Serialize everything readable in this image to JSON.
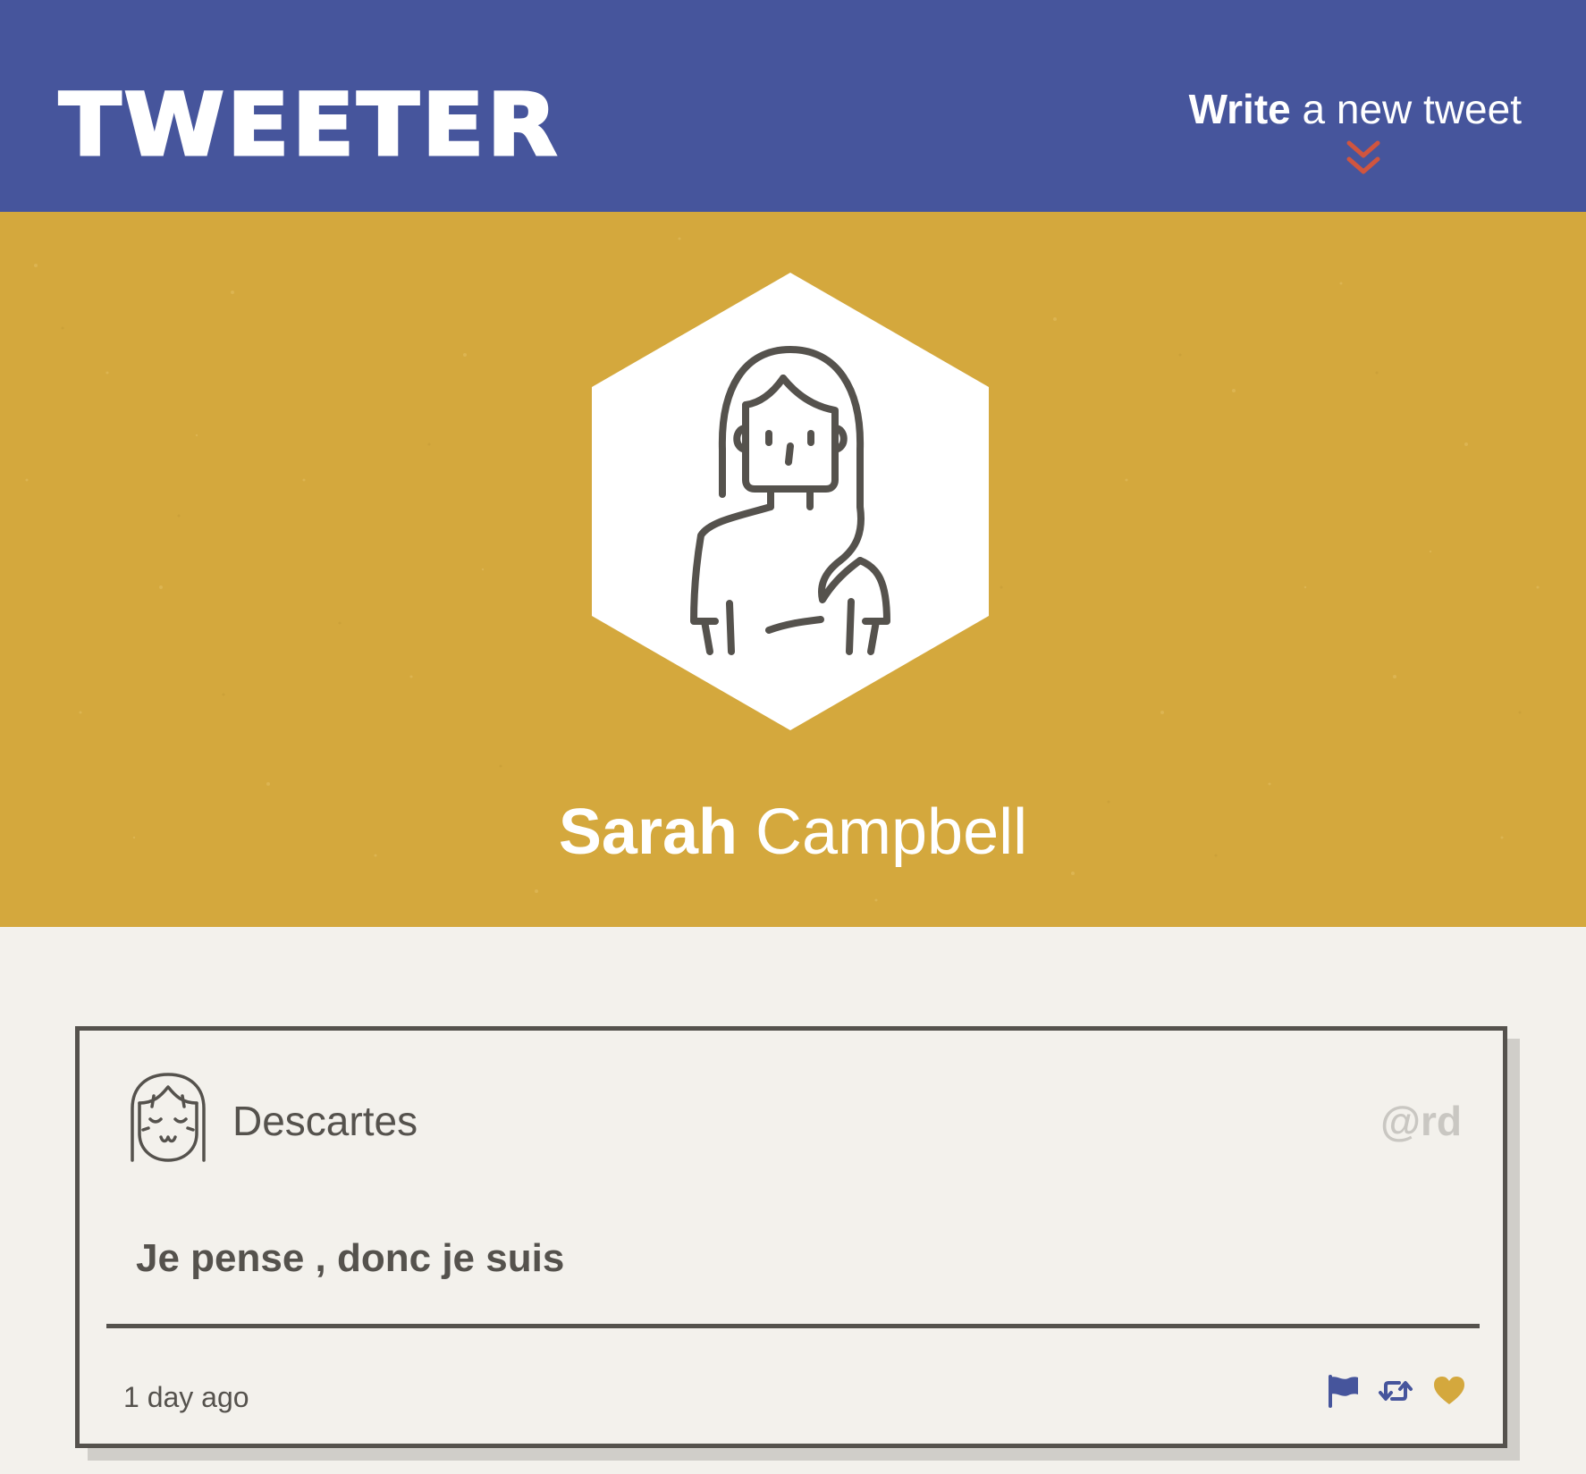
{
  "header": {
    "logo": "TWEETER",
    "write_link": {
      "strong": "Write",
      "rest": " a new tweet"
    },
    "chevron_icon": "double-chevron-down-icon"
  },
  "profile": {
    "first_name": "Sarah",
    "last_name": " Campbell",
    "avatar_icon": "woman-avatar-icon"
  },
  "tweet": {
    "author_name": "Descartes",
    "handle": "@rd",
    "text": "Je pense , donc je suis",
    "time": "1 day ago",
    "avatar_icon": "girl-avatar-icon",
    "actions": [
      "flag-icon",
      "retweet-icon",
      "heart-icon"
    ]
  },
  "colors": {
    "header_bg": "#46559c",
    "hero_bg": "#d4a83d",
    "page_bg": "#f3f1ec",
    "ink": "#55524d",
    "handle": "#c9c7c2",
    "accent_red": "#d0553f",
    "flag": "#46559c",
    "retweet": "#46559c",
    "heart": "#d4a83d"
  }
}
